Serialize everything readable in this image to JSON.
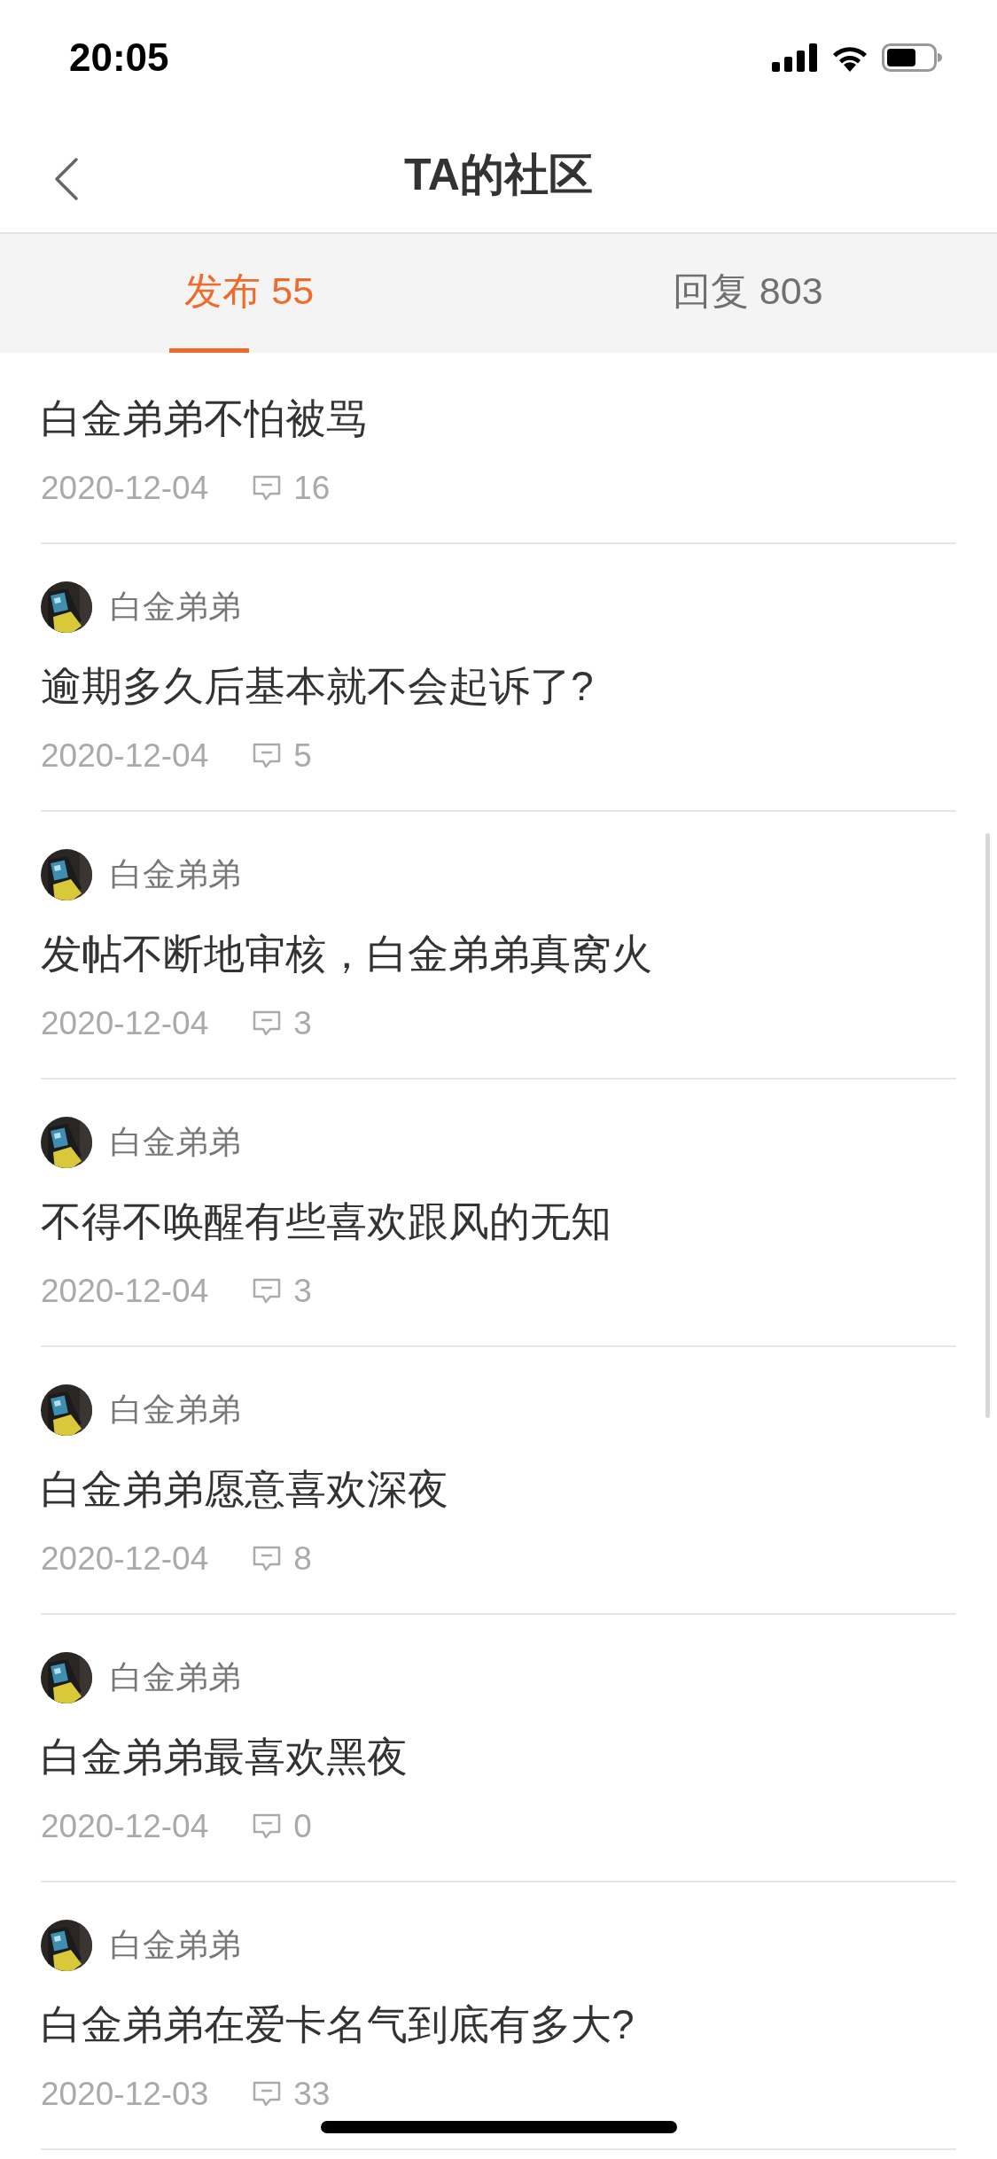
{
  "status_bar": {
    "time": "20:05"
  },
  "nav": {
    "title": "TA的社区"
  },
  "tabs": [
    {
      "label": "发布 55",
      "selected": true
    },
    {
      "label": "回复 803",
      "selected": false
    }
  ],
  "posts": [
    {
      "title": "白金弟弟不怕被骂",
      "date": "2020-12-04",
      "comments": "16"
    },
    {
      "author": "白金弟弟",
      "title": "逾期多久后基本就不会起诉了?",
      "date": "2020-12-04",
      "comments": "5"
    },
    {
      "author": "白金弟弟",
      "title": "发帖不断地审核，白金弟弟真窝火",
      "date": "2020-12-04",
      "comments": "3"
    },
    {
      "author": "白金弟弟",
      "title": "不得不唤醒有些喜欢跟风的无知",
      "date": "2020-12-04",
      "comments": "3"
    },
    {
      "author": "白金弟弟",
      "title": "白金弟弟愿意喜欢深夜",
      "date": "2020-12-04",
      "comments": "8"
    },
    {
      "author": "白金弟弟",
      "title": "白金弟弟最喜欢黑夜",
      "date": "2020-12-04",
      "comments": "0"
    },
    {
      "author": "白金弟弟",
      "title": "白金弟弟在爱卡名气到底有多大?",
      "date": "2020-12-03",
      "comments": "33"
    }
  ]
}
